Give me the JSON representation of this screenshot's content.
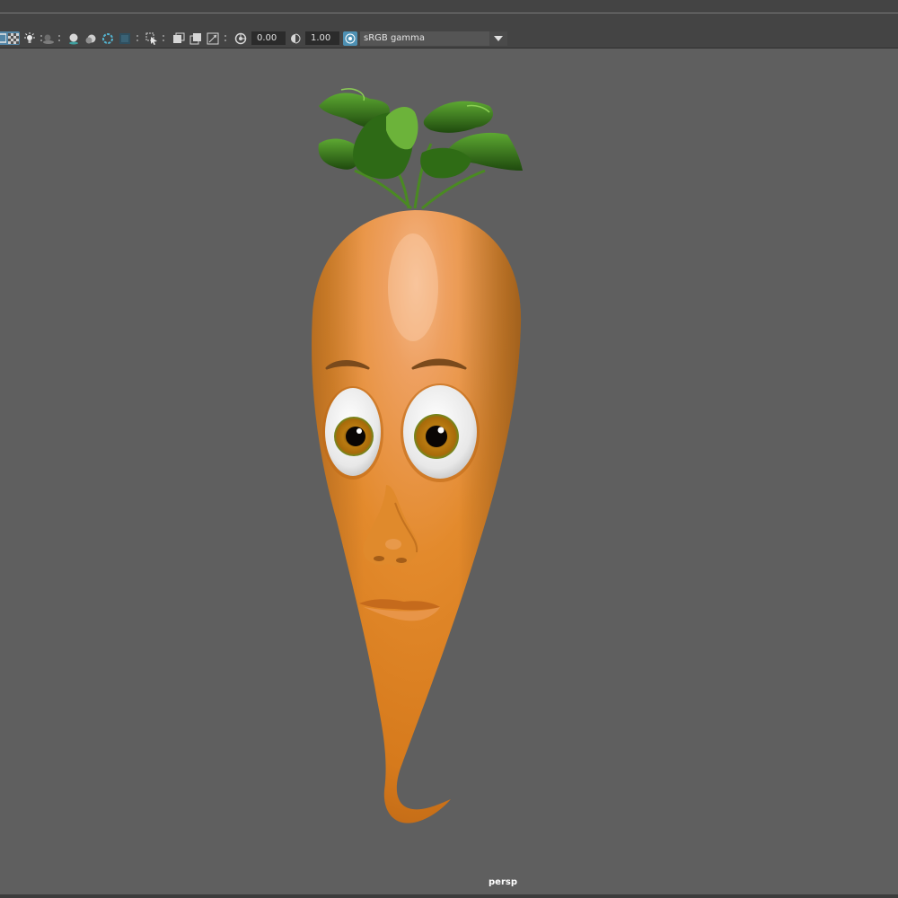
{
  "toolbar": {
    "icons": [
      "wireframe-on-shaded-icon",
      "xray-checker-icon",
      "lighting-icon",
      "shadows-icon",
      "ambient-occlusion-icon",
      "motion-blur-icon",
      "anti-aliasing-icon",
      "depth-of-field-icon",
      "isolate-select-icon",
      "gate-mask-icon",
      "resolution-gate-icon",
      "safe-action-icon",
      "exposure-icon",
      "gamma-icon",
      "color-management-icon"
    ],
    "exposure_value": "0.00",
    "gamma_value": "1.00",
    "color_space": "sRGB gamma"
  },
  "viewport": {
    "camera_label": "persp"
  },
  "colors": {
    "viewport_bg": "#5f5f5f",
    "toolbar_bg": "#444444",
    "field_bg": "#2b2b2b",
    "accent_blue": "#5285a6",
    "carrot_orange": "#e08a2a",
    "leaf_green": "#3f8a1e"
  }
}
